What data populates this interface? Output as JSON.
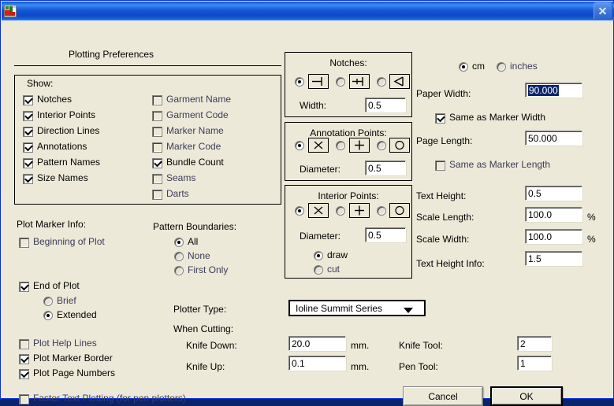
{
  "window": {
    "title": "",
    "icon": "app-icon",
    "close_label": "Close"
  },
  "header": {
    "title": "Plotting Preferences"
  },
  "show_group": {
    "legend": "Show:",
    "left_items": [
      {
        "label": "Notches",
        "checked": true
      },
      {
        "label": "Interior Points",
        "checked": true
      },
      {
        "label": "Direction Lines",
        "checked": true
      },
      {
        "label": "Annotations",
        "checked": true
      },
      {
        "label": "Pattern Names",
        "checked": true
      },
      {
        "label": "Size Names",
        "checked": true
      }
    ],
    "right_items": [
      {
        "label": "Garment Name",
        "checked": false
      },
      {
        "label": "Garment Code",
        "checked": false
      },
      {
        "label": "Marker Name",
        "checked": false
      },
      {
        "label": "Marker Code",
        "checked": false
      },
      {
        "label": "Bundle Count",
        "checked": true
      },
      {
        "label": "Seams",
        "checked": false
      },
      {
        "label": "Darts",
        "checked": false
      }
    ]
  },
  "plot_marker_info": {
    "legend": "Plot Marker Info:",
    "beginning_of_plot": {
      "label": "Beginning of Plot",
      "checked": false
    },
    "end_of_plot": {
      "label": "End of Plot",
      "checked": true
    },
    "detail_options": [
      {
        "label": "Brief",
        "selected": false
      },
      {
        "label": "Extended",
        "selected": true
      }
    ]
  },
  "pattern_boundaries": {
    "legend": "Pattern Boundaries:",
    "options": [
      {
        "label": "All",
        "selected": true
      },
      {
        "label": "None",
        "selected": false
      },
      {
        "label": "First Only",
        "selected": false
      }
    ]
  },
  "plot_options": [
    {
      "label": "Plot Help Lines",
      "checked": false
    },
    {
      "label": "Plot Marker Border",
      "checked": true
    },
    {
      "label": "Plot Page Numbers",
      "checked": true
    }
  ],
  "faster_text": {
    "label": "Faster Text Plotting (for pen plotters)",
    "checked": false
  },
  "notches": {
    "legend": "Notches:",
    "styles": [
      {
        "icon": "slit-notch-icon",
        "selected": true
      },
      {
        "icon": "t-notch-icon",
        "selected": false
      },
      {
        "icon": "v-notch-icon",
        "selected": false
      }
    ],
    "width_label": "Width:",
    "width_value": "0.5"
  },
  "annotation_points": {
    "legend": "Annotation Points:",
    "styles": [
      {
        "icon": "cross-x-icon",
        "selected": true
      },
      {
        "icon": "plus-icon",
        "selected": false
      },
      {
        "icon": "circle-icon",
        "selected": false
      }
    ],
    "diameter_label": "Diameter:",
    "diameter_value": "0.5"
  },
  "interior_points": {
    "legend": "Interior Points:",
    "styles": [
      {
        "icon": "cross-x-icon",
        "selected": true
      },
      {
        "icon": "plus-icon",
        "selected": false
      },
      {
        "icon": "circle-icon",
        "selected": false
      }
    ],
    "diameter_label": "Diameter:",
    "diameter_value": "0.5",
    "mode_options": [
      {
        "label": "draw",
        "selected": true
      },
      {
        "label": "cut",
        "selected": false
      }
    ]
  },
  "units": {
    "cm": {
      "label": "cm",
      "selected": true
    },
    "inches": {
      "label": "inches",
      "selected": false
    }
  },
  "paper": {
    "width_label": "Paper Width:",
    "width_value": "90.000",
    "width_selected": true,
    "same_as_marker_width": {
      "label": "Same as Marker Width",
      "checked": true
    },
    "length_label": "Page Length:",
    "length_value": "50.000",
    "same_as_marker_length": {
      "label": "Same as Marker Length",
      "checked": false
    }
  },
  "text_fields": [
    {
      "label": "Text Height:",
      "value": "0.5",
      "suffix": ""
    },
    {
      "label": "Scale Length:",
      "value": "100.0",
      "suffix": "%"
    },
    {
      "label": "Scale Width:",
      "value": "100.0",
      "suffix": "%"
    },
    {
      "label": "Text Height Info:",
      "value": "1.5",
      "suffix": ""
    }
  ],
  "plotter": {
    "type_label": "Plotter Type:",
    "type_value": "Ioline Summit Series",
    "when_cutting_label": "When Cutting:",
    "knife_down_label": "Knife Down:",
    "knife_down_value": "20.0",
    "knife_down_unit": "mm.",
    "knife_up_label": "Knife Up:",
    "knife_up_value": "0.1",
    "knife_up_unit": "mm.",
    "knife_tool_label": "Knife Tool:",
    "knife_tool_value": "2",
    "pen_tool_label": "Pen Tool:",
    "pen_tool_value": "1"
  },
  "buttons": {
    "cancel": "Cancel",
    "ok": "OK"
  },
  "colors": {
    "dialog_face": "#ece9d8",
    "title_blue": "#0a52d6",
    "selection_blue": "#0a246a",
    "field_white": "#ffffff"
  }
}
